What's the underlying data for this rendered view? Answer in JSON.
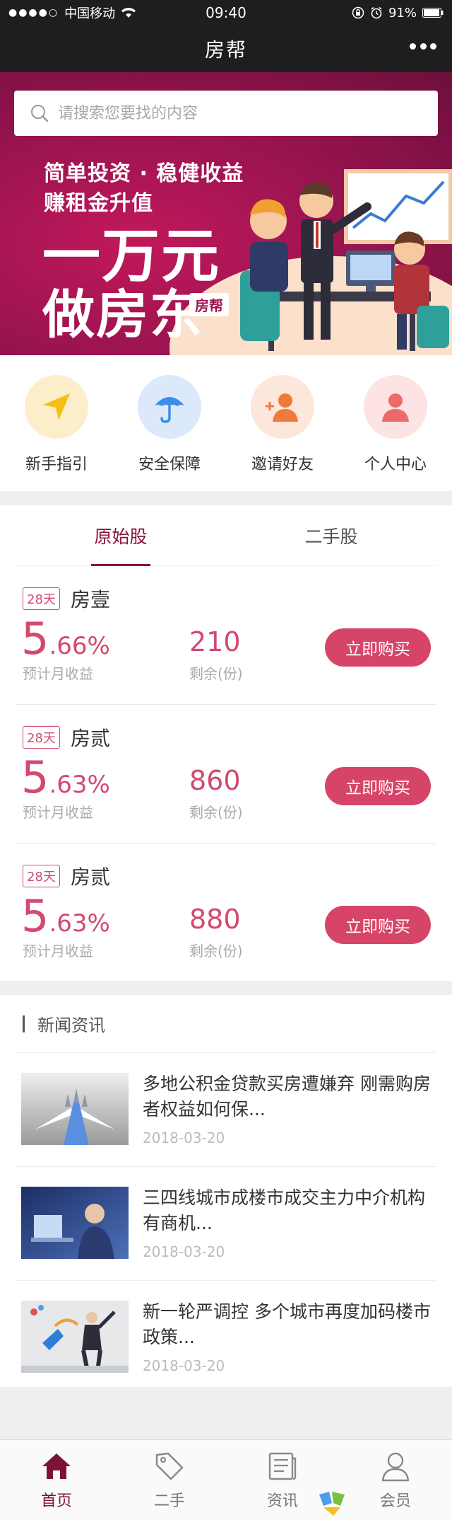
{
  "status_bar": {
    "carrier": "中国移动",
    "time": "09:40",
    "battery": "91%"
  },
  "nav": {
    "title": "房帮"
  },
  "search": {
    "placeholder": "请搜索您要找的内容"
  },
  "banner": {
    "tagline1": "简单投资 · 稳健收益",
    "tagline2": "赚租金升值",
    "headline1": "一万元",
    "headline2": "做房东",
    "badge": "房帮"
  },
  "quick_menu": [
    {
      "label": "新手指引",
      "icon": "navigation-arrow-icon",
      "color": "#fdeecb"
    },
    {
      "label": "安全保障",
      "icon": "umbrella-icon",
      "color": "#dbe9fb"
    },
    {
      "label": "邀请好友",
      "icon": "add-user-icon",
      "color": "#fde6da"
    },
    {
      "label": "个人中心",
      "icon": "user-icon",
      "color": "#fde3e3"
    }
  ],
  "product_tabs": [
    "原始股",
    "二手股"
  ],
  "products": [
    {
      "term": "28天",
      "name": "房壹",
      "rate_int": "5",
      "rate_dec": ".66%",
      "rate_label": "预计月收益",
      "remaining": "210",
      "remaining_label": "剩余(份)",
      "buy_label": "立即购买"
    },
    {
      "term": "28天",
      "name": "房贰",
      "rate_int": "5",
      "rate_dec": ".63%",
      "rate_label": "预计月收益",
      "remaining": "860",
      "remaining_label": "剩余(份)",
      "buy_label": "立即购买"
    },
    {
      "term": "28天",
      "name": "房贰",
      "rate_int": "5",
      "rate_dec": ".63%",
      "rate_label": "预计月收益",
      "remaining": "880",
      "remaining_label": "剩余(份)",
      "buy_label": "立即购买"
    }
  ],
  "news": {
    "heading": "新闻资讯",
    "items": [
      {
        "title": "多地公积金贷款买房遭嫌弃 刚需购房者权益如何保...",
        "date": "2018-03-20"
      },
      {
        "title": "三四线城市成楼市成交主力中介机构有商机...",
        "date": "2018-03-20"
      },
      {
        "title": "新一轮严调控 多个城市再度加码楼市政策...",
        "date": "2018-03-20"
      }
    ]
  },
  "tabbar": [
    {
      "label": "首页",
      "icon": "home-icon",
      "active": true
    },
    {
      "label": "二手",
      "icon": "tag-icon",
      "active": false
    },
    {
      "label": "资讯",
      "icon": "news-icon",
      "active": false
    },
    {
      "label": "会员",
      "icon": "member-icon",
      "active": false
    }
  ],
  "colors": {
    "brand": "#8a1340",
    "accent": "#d64468",
    "topbar": "#1e1e1e"
  }
}
